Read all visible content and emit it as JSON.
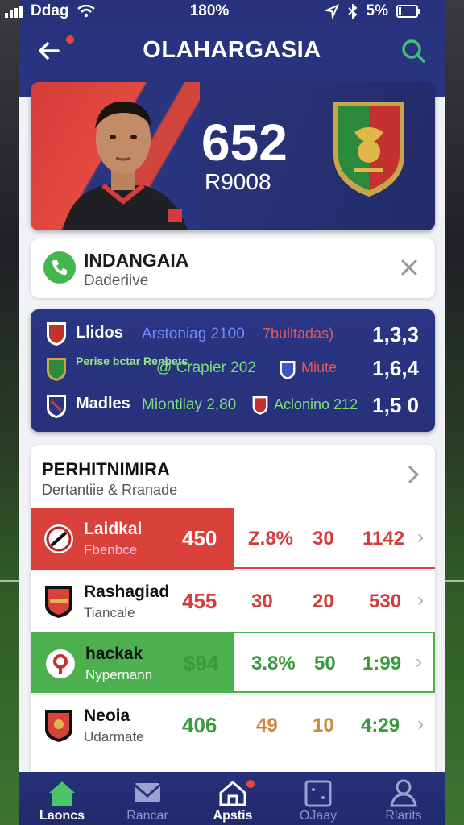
{
  "status_bar": {
    "carrier": "Ddag",
    "time": "180%",
    "battery": "5%"
  },
  "header": {
    "title": "OLAHARGASIA"
  },
  "hero": {
    "score": "652",
    "code": "R9008"
  },
  "call_card": {
    "title": "INDANGAIA",
    "subtitle": "Daderiive"
  },
  "fixtures": [
    {
      "team": "Llidos",
      "middle": "Arstoniag 2100",
      "away": "7bulltadas)",
      "odds": "1,3,3",
      "middle_color": "#6f8cff",
      "away_color": "#e05a5a"
    },
    {
      "team": "Perise bctar Renbets",
      "middle": "@ Crapier 202",
      "away": "Miute",
      "odds": "1,6,4",
      "middle_color": "#7be07a",
      "away_color": "#e05a5a"
    },
    {
      "team": "Madles",
      "middle": "Miontilay 2,80",
      "away": "Aclonino 212",
      "odds": "1,5 0",
      "middle_color": "#7be07a",
      "away_color": "#7be07a"
    }
  ],
  "table": {
    "title": "PERHITNIMIRA",
    "subtitle": "Dertantiie & Rranade",
    "rows": [
      {
        "name": "Laidkal",
        "sub": "Fbenbce",
        "v1": "450",
        "c1": "Z.8%",
        "c2": "30",
        "c3": "1142",
        "theme": "red"
      },
      {
        "name": "Rashagiad",
        "sub": "Tiancale",
        "v1": "455",
        "c1": "30",
        "c2": "20",
        "c3": "530",
        "theme": "white"
      },
      {
        "name": "hackak",
        "sub": "Nypernann",
        "v1": "$94",
        "c1": "3.8%",
        "c2": "50",
        "c3": "1:99",
        "theme": "green"
      },
      {
        "name": "Neoia",
        "sub": "Udarmate",
        "v1": "406",
        "c1": "49",
        "c2": "10",
        "c3": "4:29",
        "theme": "white"
      }
    ]
  },
  "tabs": [
    {
      "label": "Laoncs",
      "icon": "home-icon"
    },
    {
      "label": "Rancar",
      "icon": "mail-icon"
    },
    {
      "label": "Apstis",
      "icon": "house-icon"
    },
    {
      "label": "OJaay",
      "icon": "calendar-icon"
    },
    {
      "label": "Rlarits",
      "icon": "profile-icon"
    }
  ]
}
